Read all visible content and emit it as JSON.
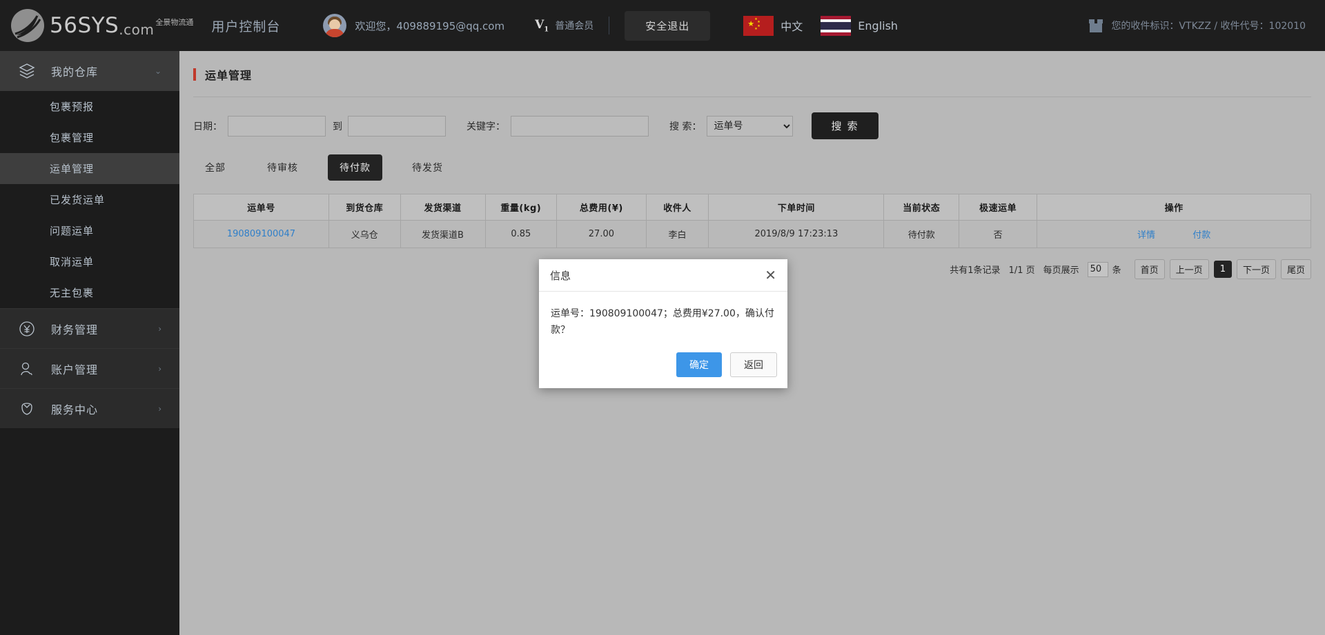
{
  "header": {
    "logo_main": "56SYS",
    "logo_dotcom": ".com",
    "logo_cn": "全景物流通",
    "console_title": "用户控制台",
    "welcome": "欢迎您，409889195@qq.com",
    "vip_badge": "V",
    "vip_badge_sub": "1",
    "vip_label": "普通会员",
    "logout_label": "安全退出",
    "languages": [
      {
        "flag": "cn-flag-icon",
        "label": "中文"
      },
      {
        "flag": "th-flag-icon",
        "label": "English"
      }
    ],
    "package_icon": "package-box-icon",
    "package_info": "您的收件标识：VTKZZ / 收件代号：102010"
  },
  "sidebar": {
    "groups": [
      {
        "label": "我的仓库",
        "icon": "layers-icon",
        "arrow": "chevron-down-icon",
        "expanded": true,
        "items": [
          {
            "label": "包裹预报",
            "active": false
          },
          {
            "label": "包裹管理",
            "active": false
          },
          {
            "label": "运单管理",
            "active": true
          },
          {
            "label": "已发货运单",
            "active": false
          },
          {
            "label": "问题运单",
            "active": false
          },
          {
            "label": "取消运单",
            "active": false
          },
          {
            "label": "无主包裹",
            "active": false
          }
        ]
      },
      {
        "label": "财务管理",
        "icon": "yuan-circle-icon",
        "arrow": "chevron-right-icon",
        "expanded": false,
        "items": []
      },
      {
        "label": "账户管理",
        "icon": "user-icon",
        "arrow": "chevron-right-icon",
        "expanded": false,
        "items": []
      },
      {
        "label": "服务中心",
        "icon": "flower-icon",
        "arrow": "chevron-right-icon",
        "expanded": false,
        "items": []
      }
    ]
  },
  "main": {
    "page_title": "运单管理",
    "filter": {
      "date_label": "日期：",
      "date_from_value": "",
      "date_from_placeholder": "",
      "to_label": "到",
      "date_to_value": "",
      "date_to_placeholder": "",
      "keyword_label": "关键字：",
      "keyword_value": "",
      "keyword_placeholder": "",
      "search_label": "搜 索：",
      "search_field_selected": "运单号",
      "search_field_options": [
        "运单号"
      ],
      "search_button": "搜 索"
    },
    "tabs": [
      {
        "label": "全部",
        "active": false
      },
      {
        "label": "待审核",
        "active": false
      },
      {
        "label": "待付款",
        "active": true
      },
      {
        "label": "待发货",
        "active": false
      }
    ],
    "table": {
      "columns": [
        "运单号",
        "到货仓库",
        "发货渠道",
        "重量(kg)",
        "总费用(¥)",
        "收件人",
        "下单时间",
        "当前状态",
        "极速运单",
        "操作"
      ],
      "rows": [
        {
          "waybill_no": "190809100047",
          "warehouse": "义乌仓",
          "channel": "发货渠道B",
          "weight": "0.85",
          "total_fee": "27.00",
          "recipient": "李白",
          "order_time": "2019/8/9 17:23:13",
          "status": "待付款",
          "express": "否",
          "action_detail": "详情",
          "action_pay": "付款"
        }
      ]
    },
    "pagination": {
      "total_text": "共有1条记录",
      "page_text": "1/1 页",
      "per_page_label": "每页展示",
      "per_page_value": "50",
      "per_page_unit": "条",
      "first": "首页",
      "prev": "上一页",
      "current": "1",
      "next": "下一页",
      "last": "尾页"
    }
  },
  "modal": {
    "title": "信息",
    "close_icon": "close-icon",
    "message": "运单号：190809100047；总费用¥27.00，确认付款？",
    "confirm_label": "确定",
    "cancel_label": "返回"
  },
  "colors": {
    "header_bg": "#1e1e1e",
    "sidebar_bg": "#1c1c1c",
    "sidebar_active": "#3e3e3e",
    "content_bg": "#b8b8b8",
    "accent_red": "#c0392b",
    "link_blue": "#2f7fc9",
    "primary_blue": "#3d96e8",
    "dark_btn": "#1f1f1f"
  }
}
